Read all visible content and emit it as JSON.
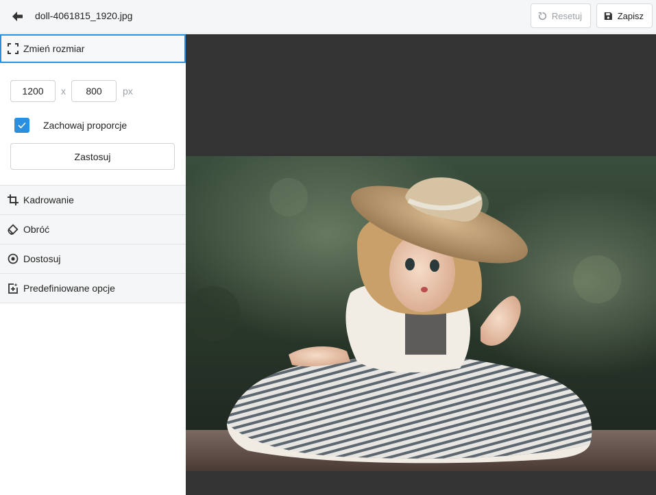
{
  "header": {
    "filename": "doll-4061815_1920.jpg",
    "reset_label": "Resetuj",
    "save_label": "Zapisz"
  },
  "sidebar": {
    "resize": {
      "label": "Zmień rozmiar",
      "width_value": "1200",
      "height_value": "800",
      "times": "x",
      "unit": "px",
      "keep_ratio_label": "Zachowaj proporcje",
      "keep_ratio_checked": true,
      "apply_label": "Zastosuj"
    },
    "sections": [
      {
        "label": "Kadrowanie",
        "icon": "crop-icon"
      },
      {
        "label": "Obróć",
        "icon": "rotate-icon"
      },
      {
        "label": "Dostosuj",
        "icon": "adjust-icon"
      },
      {
        "label": "Predefiniowane opcje",
        "icon": "presets-icon"
      }
    ]
  },
  "colors": {
    "accent": "#2b8fe0",
    "canvas_bg": "#333333",
    "header_bg": "#f5f6f7"
  }
}
